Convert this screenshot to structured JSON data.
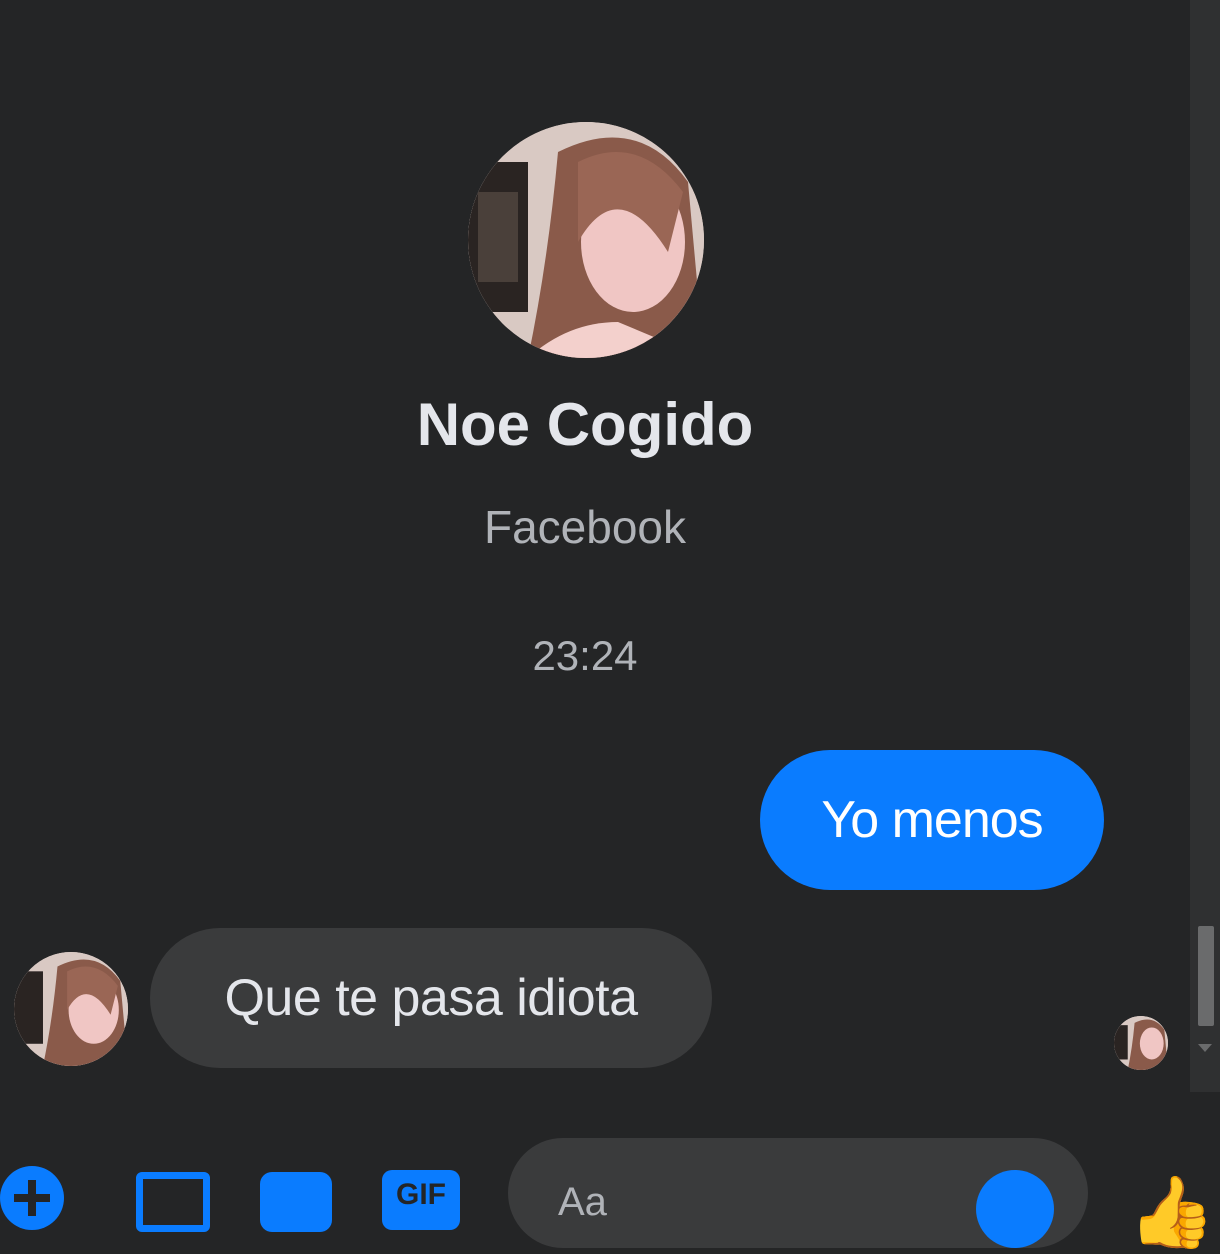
{
  "contact": {
    "name": "Noe Cogido",
    "platform": "Facebook"
  },
  "conversation": {
    "timestamp": "23:24",
    "messages": [
      {
        "direction": "outgoing",
        "text": "Yo menos"
      },
      {
        "direction": "incoming",
        "text": "Que te pasa idiota"
      }
    ]
  },
  "composer": {
    "placeholder": "Aa",
    "gif_label": "GIF",
    "icons": [
      "plus-icon",
      "image-icon",
      "sticker-icon",
      "gif-icon",
      "emoji-icon",
      "like-icon"
    ]
  },
  "colors": {
    "background": "#242526",
    "outgoing_bubble": "#0a7cff",
    "incoming_bubble": "#3a3b3c",
    "accent": "#0a7cff"
  }
}
